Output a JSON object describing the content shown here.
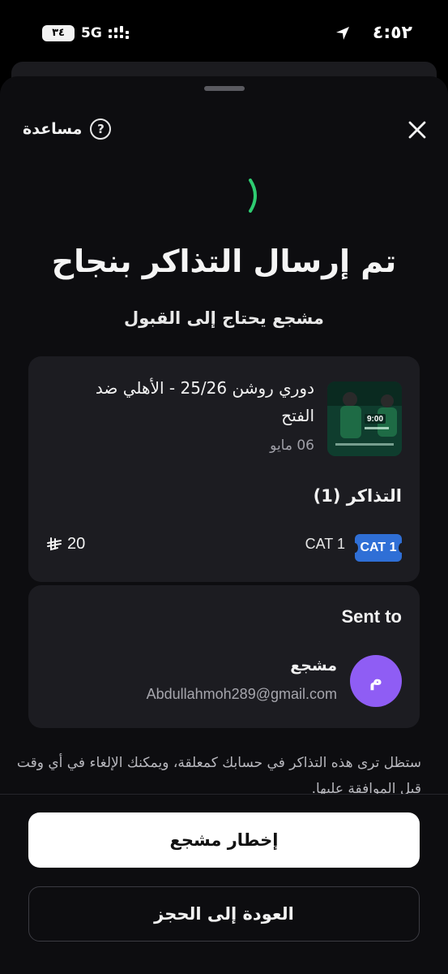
{
  "status_bar": {
    "time": "٤:٥٢",
    "battery": "٣٤",
    "network": "5G",
    "icons": [
      "location-arrow-icon",
      "signal-bars-icon",
      "battery-icon"
    ]
  },
  "header": {
    "help_label": "مساعدة",
    "help_icon": "question-circle-icon",
    "close_icon": "close-icon"
  },
  "status": {
    "spinner_color": "#2ecc71",
    "title": "تم إرسال التذاكر بنجاح",
    "subtitle": "مشجع يحتاج إلى القبول"
  },
  "event": {
    "thumb_overlay_time": "9:00",
    "title": "دوري روشن 25/26 - الأهلي ضد الفتح",
    "date": "06 مايو"
  },
  "tickets": {
    "heading": "التذاكر (1)",
    "items": [
      {
        "badge": "CAT 1",
        "label": "CAT 1",
        "price": "20",
        "currency_icon": "saudi-riyal-icon"
      }
    ],
    "badge_color": "#2f6fd6"
  },
  "recipient": {
    "heading": "Sent to",
    "avatar_letter": "م",
    "avatar_color": "#8f5df4",
    "name": "مشجع",
    "email": "Abdullahmoh289@gmail.com"
  },
  "note": "ستظل ترى هذه التذاكر في حسابك كمعلقة، ويمكنك الإلغاء في أي وقت قبل الموافقة عليها.",
  "actions": {
    "notify_label": "إخطار مشجع",
    "back_label": "العودة إلى الحجز"
  }
}
